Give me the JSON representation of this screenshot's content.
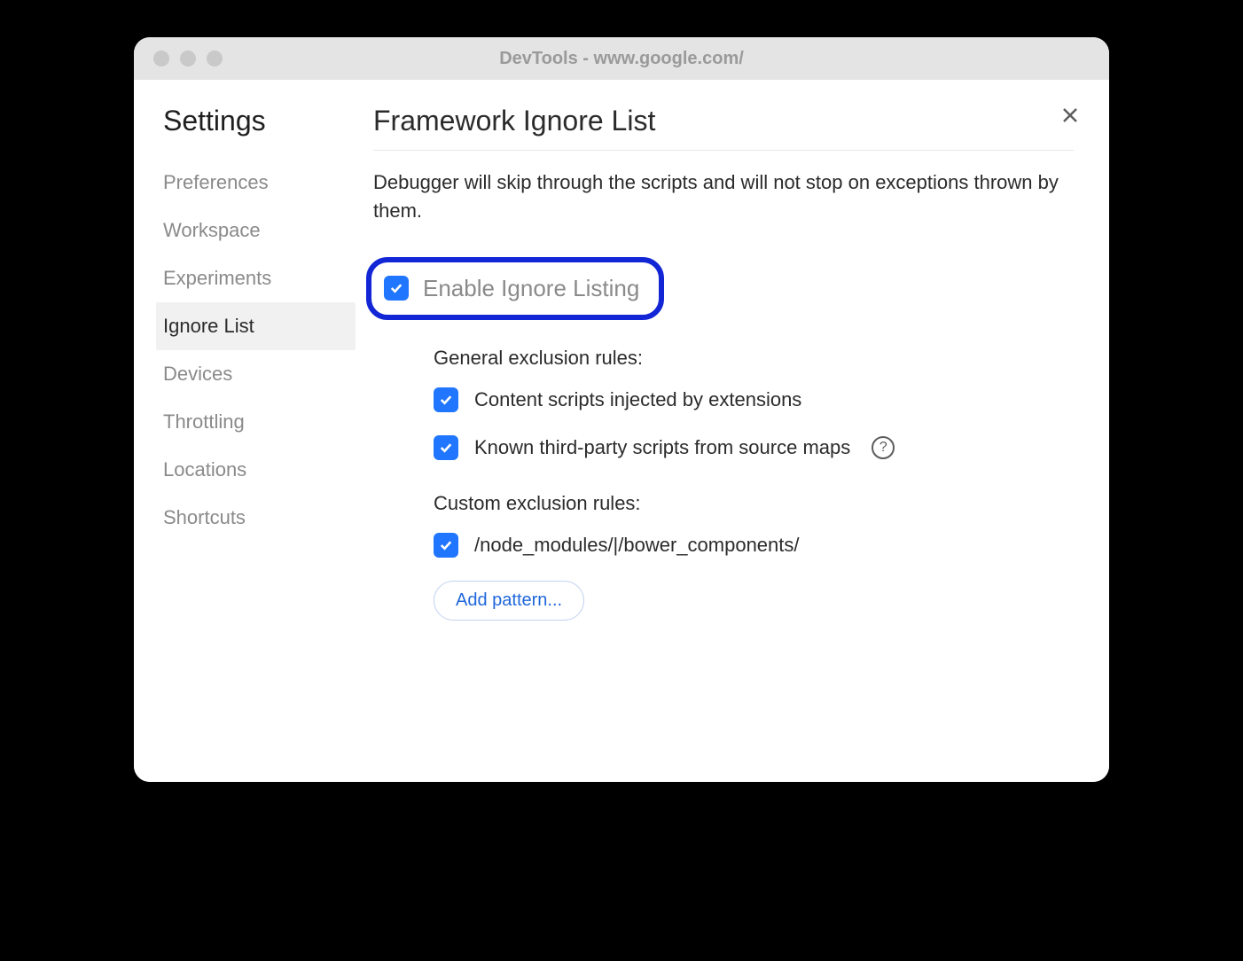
{
  "window": {
    "title": "DevTools - www.google.com/"
  },
  "sidebar": {
    "title": "Settings",
    "items": [
      {
        "label": "Preferences",
        "active": false
      },
      {
        "label": "Workspace",
        "active": false
      },
      {
        "label": "Experiments",
        "active": false
      },
      {
        "label": "Ignore List",
        "active": true
      },
      {
        "label": "Devices",
        "active": false
      },
      {
        "label": "Throttling",
        "active": false
      },
      {
        "label": "Locations",
        "active": false
      },
      {
        "label": "Shortcuts",
        "active": false
      }
    ]
  },
  "main": {
    "title": "Framework Ignore List",
    "description": "Debugger will skip through the scripts and will not stop on exceptions thrown by them.",
    "enable_label": "Enable Ignore Listing",
    "enable_checked": true,
    "general_heading": "General exclusion rules:",
    "general_rules": [
      {
        "label": "Content scripts injected by extensions",
        "checked": true,
        "help": false
      },
      {
        "label": "Known third-party scripts from source maps",
        "checked": true,
        "help": true
      }
    ],
    "custom_heading": "Custom exclusion rules:",
    "custom_rules": [
      {
        "label": "/node_modules/|/bower_components/",
        "checked": true
      }
    ],
    "add_pattern_label": "Add pattern..."
  }
}
